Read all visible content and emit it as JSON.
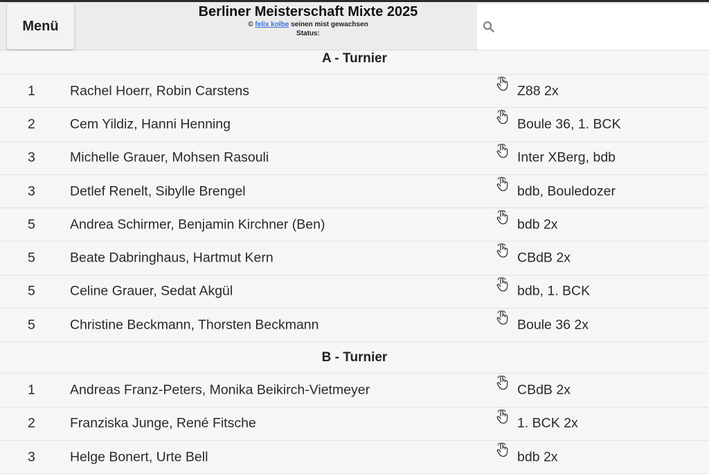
{
  "header": {
    "menu_label": "Menü",
    "title": "Berliner Meisterschaft Mixte 2025",
    "credit_symbol": "©",
    "credit_link": "felix kolbe",
    "credit_suffix": "seinen mist gewachsen",
    "status_label": "Status:"
  },
  "search": {
    "placeholder": ""
  },
  "sections": [
    {
      "title": "A - Turnier",
      "rows": [
        {
          "rank": "1",
          "names": "Rachel Hoerr, Robin Carstens",
          "club": "Z88 2x"
        },
        {
          "rank": "2",
          "names": "Cem Yildiz, Hanni Henning",
          "club": "Boule 36, 1. BCK"
        },
        {
          "rank": "3",
          "names": "Michelle Grauer, Mohsen Rasouli",
          "club": "Inter XBerg, bdb"
        },
        {
          "rank": "3",
          "names": "Detlef Renelt, Sibylle Brengel",
          "club": "bdb, Bouledozer"
        },
        {
          "rank": "5",
          "names": "Andrea Schirmer, Benjamin Kirchner (Ben)",
          "club": "bdb 2x"
        },
        {
          "rank": "5",
          "names": "Beate Dabringhaus, Hartmut Kern",
          "club": "CBdB 2x"
        },
        {
          "rank": "5",
          "names": "Celine Grauer, Sedat Akgül",
          "club": "bdb, 1. BCK"
        },
        {
          "rank": "5",
          "names": "Christine Beckmann, Thorsten Beckmann",
          "club": "Boule 36 2x"
        }
      ]
    },
    {
      "title": "B - Turnier",
      "rows": [
        {
          "rank": "1",
          "names": "Andreas Franz-Peters, Monika Beikirch-Vietmeyer",
          "club": "CBdB 2x"
        },
        {
          "rank": "2",
          "names": "Franziska Junge, René Fitsche",
          "club": "1. BCK 2x"
        },
        {
          "rank": "3",
          "names": "Helge Bonert, Urte Bell",
          "club": "bdb 2x"
        }
      ]
    }
  ],
  "icons": {
    "search": "search-icon",
    "row_action": "pointing-hand-icon"
  }
}
